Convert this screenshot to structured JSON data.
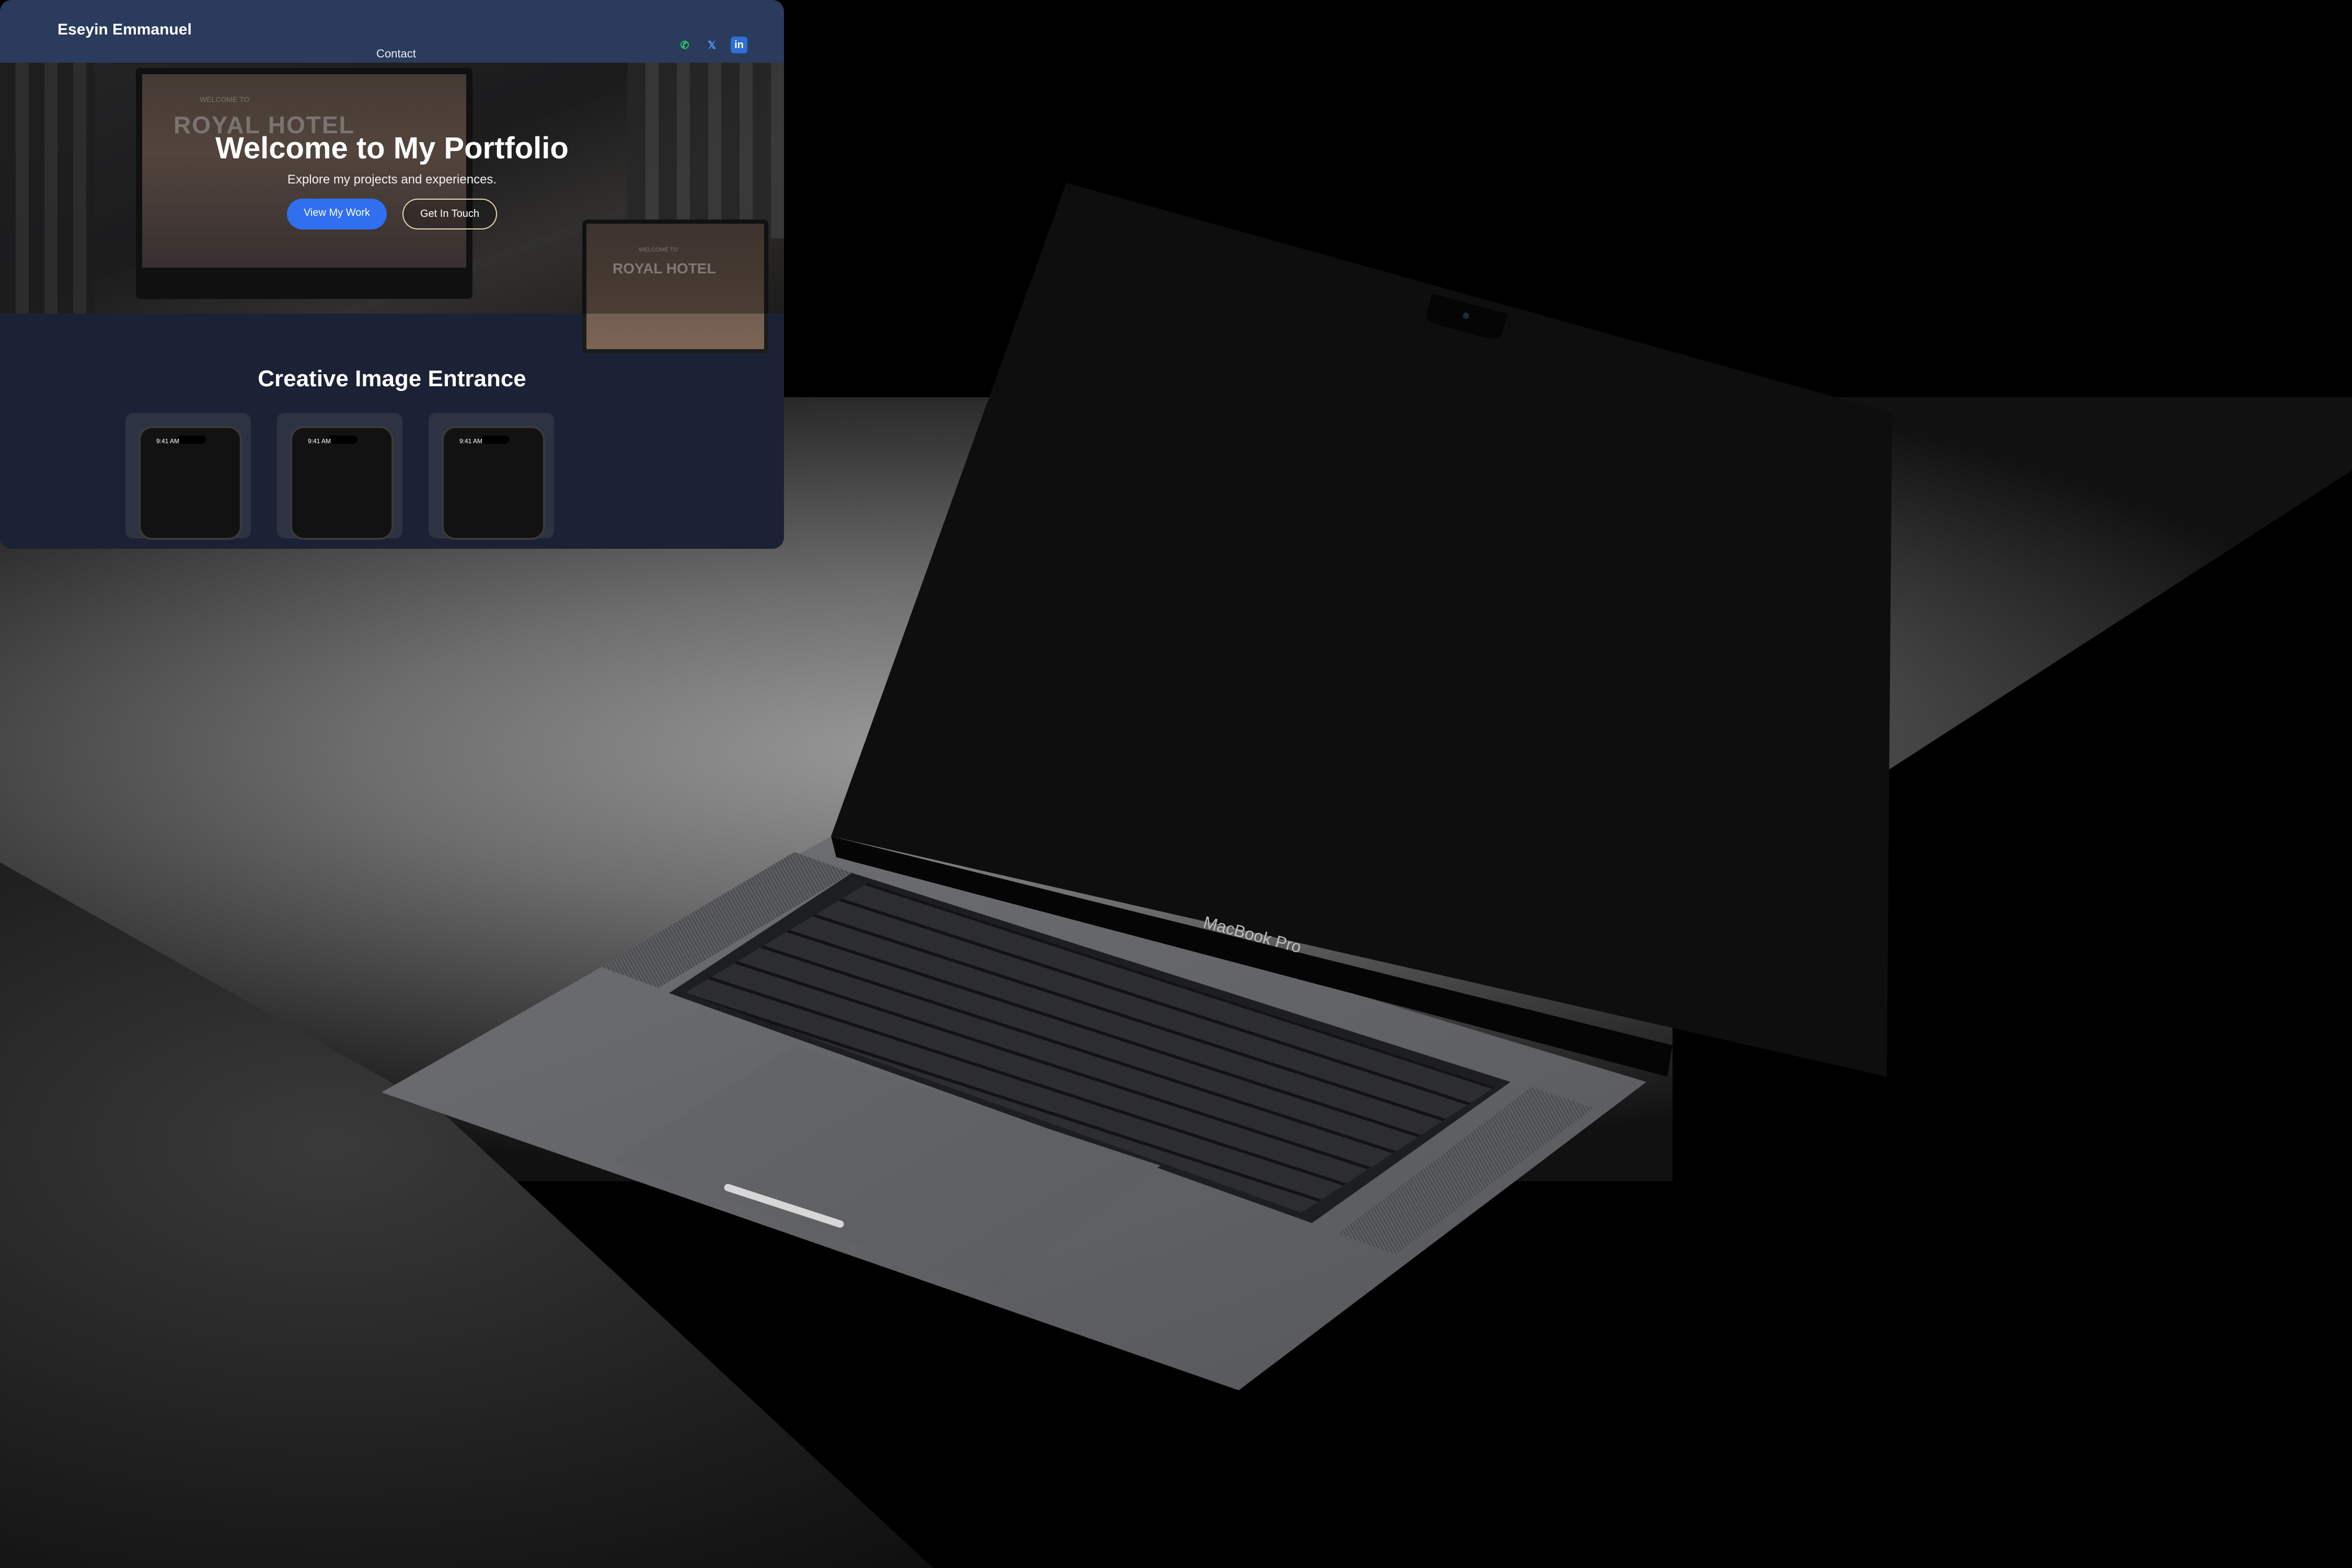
{
  "site": {
    "brand": "Eseyin Emmanuel",
    "nav_links": [
      "Contact"
    ],
    "social_icons": [
      "whatsapp-icon",
      "x-icon",
      "linkedin-icon"
    ]
  },
  "hero": {
    "title": "Welcome to My Portfolio",
    "subtitle": "Explore my projects and experiences.",
    "primary_button": "View My Work",
    "secondary_button": "Get In Touch",
    "background_monitor_text": "ROYAL HOTEL",
    "background_monitor_sub": "WELCOME TO",
    "background_laptop_text": "ROYAL HOTEL",
    "background_laptop_sub": "WELCOME TO"
  },
  "section": {
    "title": "Creative Image Entrance",
    "phones": [
      {
        "time": "9:41 AM"
      },
      {
        "time": "9:41 AM"
      },
      {
        "time": "9:41 AM"
      }
    ]
  },
  "device": {
    "model_label": "MacBook Pro"
  },
  "colors": {
    "nav_bg": "#2a3b5c",
    "page_bg": "#1b2235",
    "primary_button": "#2f6ff0",
    "whatsapp": "#25d366"
  }
}
